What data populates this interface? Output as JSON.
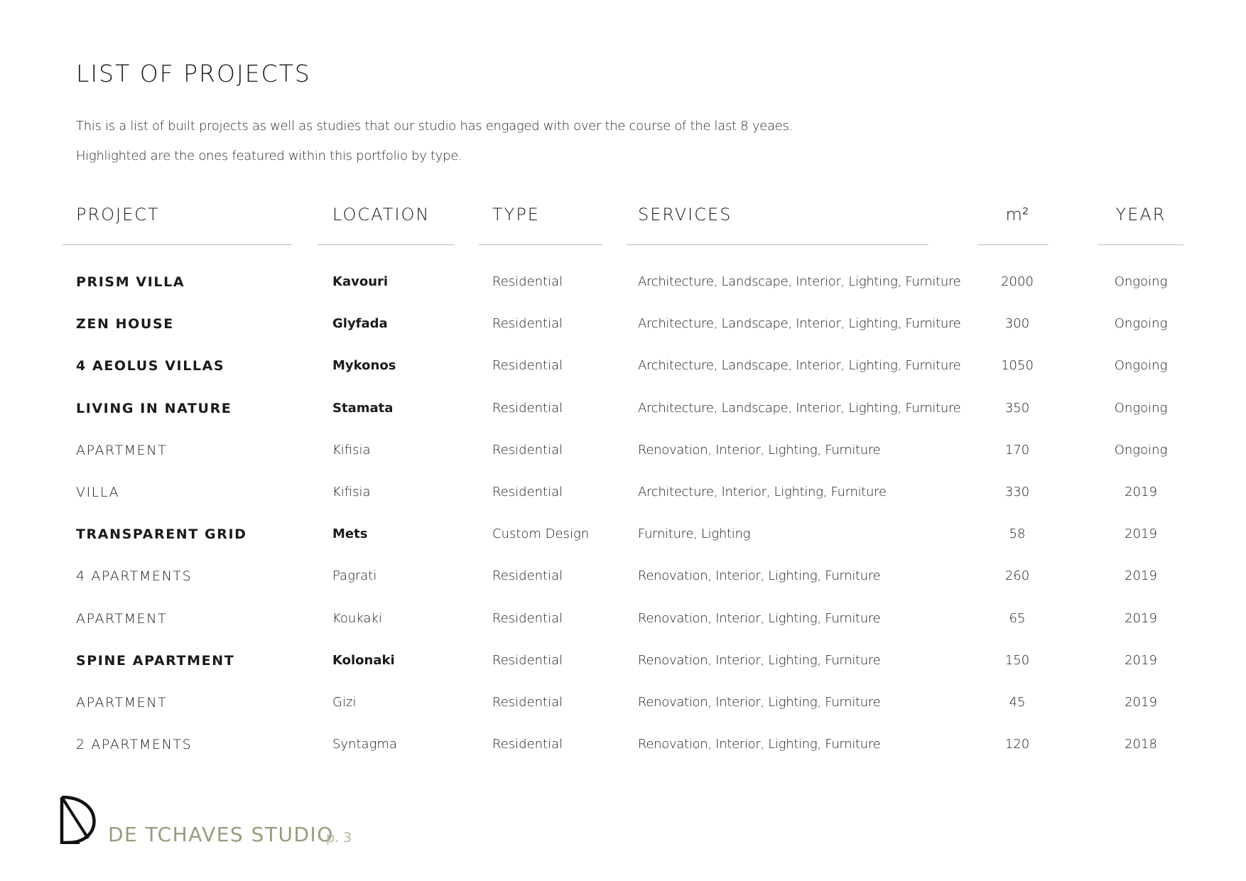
{
  "page": {
    "title": "LIST OF PROJECTS",
    "intro_line_1": "This is a list of built projects as well as studies that our studio has engaged with over the course of the last 8 yeaes.",
    "intro_line_2": "Highlighted are the ones featured within this portfolio by type."
  },
  "table": {
    "headers": {
      "project": "PROJECT",
      "location": "LOCATION",
      "type": "TYPE",
      "services": "SERVICES",
      "area": "m²",
      "year": "YEAR"
    },
    "rows": [
      {
        "project": "PRISM VILLA",
        "location": "Kavouri",
        "type": "Residential",
        "services": "Architecture, Landscape, Interior, Lighting, Furniture",
        "area": "2000",
        "year": "Ongoing",
        "highlighted": true
      },
      {
        "project": "ZEN HOUSE",
        "location": "Glyfada",
        "type": "Residential",
        "services": "Architecture, Landscape, Interior, Lighting, Furniture",
        "area": "300",
        "year": "Ongoing",
        "highlighted": true
      },
      {
        "project": "4 AEOLUS VILLAS",
        "location": "Mykonos",
        "type": "Residential",
        "services": "Architecture, Landscape, Interior, Lighting, Furniture",
        "area": "1050",
        "year": "Ongoing",
        "highlighted": true
      },
      {
        "project": "LIVING IN NATURE",
        "location": "Stamata",
        "type": "Residential",
        "services": "Architecture, Landscape, Interior, Lighting, Furniture",
        "area": "350",
        "year": "Ongoing",
        "highlighted": true
      },
      {
        "project": "APARTMENT",
        "location": "Kifisia",
        "type": "Residential",
        "services": "Renovation, Interior, Lighting, Furniture",
        "area": "170",
        "year": "Ongoing",
        "highlighted": false
      },
      {
        "project": "VILLA",
        "location": "Kifisia",
        "type": "Residential",
        "services": "Architecture, Interior, Lighting, Furniture",
        "area": "330",
        "year": "2019",
        "highlighted": false
      },
      {
        "project": "TRANSPARENT GRID",
        "location": "Mets",
        "type": "Custom Design",
        "services": "Furniture, Lighting",
        "area": "58",
        "year": "2019",
        "highlighted": true
      },
      {
        "project": "4 APARTMENTS",
        "location": "Pagrati",
        "type": "Residential",
        "services": "Renovation, Interior, Lighting, Furniture",
        "area": "260",
        "year": "2019",
        "highlighted": false
      },
      {
        "project": "APARTMENT",
        "location": "Koukaki",
        "type": "Residential",
        "services": "Renovation, Interior, Lighting, Furniture",
        "area": "65",
        "year": "2019",
        "highlighted": false
      },
      {
        "project": "SPINE APARTMENT",
        "location": "Kolonaki",
        "type": "Residential",
        "services": "Renovation, Interior, Lighting, Furniture",
        "area": "150",
        "year": "2019",
        "highlighted": true
      },
      {
        "project": "APARTMENT",
        "location": "Gizi",
        "type": "Residential",
        "services": "Renovation, Interior, Lighting, Furniture",
        "area": "45",
        "year": "2019",
        "highlighted": false
      },
      {
        "project": "2 APARTMENTS",
        "location": "Syntagma",
        "type": "Residential",
        "services": "Renovation, Interior, Lighting, Furniture",
        "area": "120",
        "year": "2018",
        "highlighted": false
      }
    ]
  },
  "footer": {
    "studio_name": "DE TCHAVES STUDIO",
    "page_number": "p. 3",
    "brand_color": "#9b9a7c",
    "logo_icon": "dt-monogram-icon"
  }
}
